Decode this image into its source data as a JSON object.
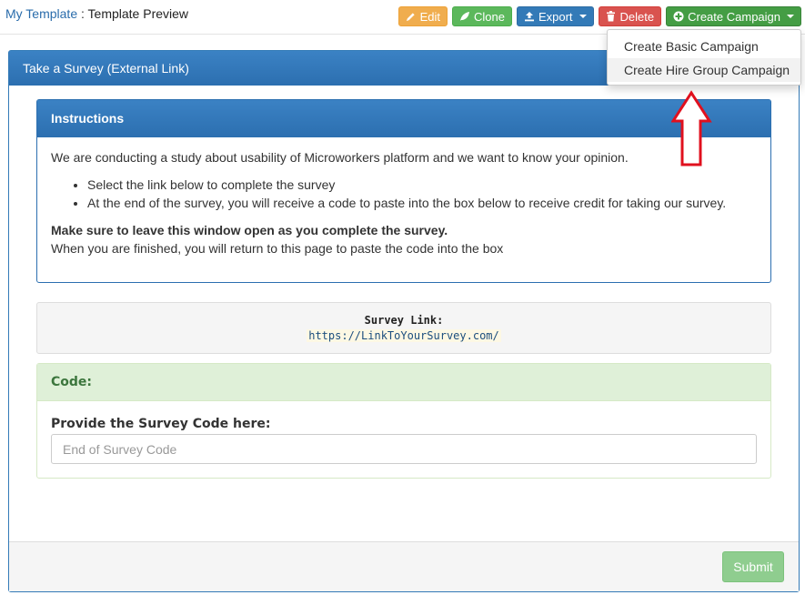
{
  "breadcrumb": {
    "link": "My Template",
    "separator": " : ",
    "current": "Template Preview"
  },
  "toolbar": {
    "edit_label": "Edit",
    "clone_label": "Clone",
    "export_label": "Export",
    "delete_label": "Delete",
    "create_label": "Create Campaign"
  },
  "dropdown": {
    "items": [
      {
        "label": "Create Basic Campaign"
      },
      {
        "label": "Create Hire Group Campaign"
      }
    ]
  },
  "panel": {
    "title": "Take a Survey (External Link)"
  },
  "instructions": {
    "title": "Instructions",
    "intro": "We are conducting a study about usability of Microworkers platform and we want to know your opinion.",
    "bullets": [
      "Select the link below to complete the survey",
      "At the end of the survey, you will receive a code to paste into the box below to receive credit for taking our survey."
    ],
    "warning": "Make sure to leave this window open as you complete the survey.",
    "note": "When you are finished, you will return to this page to paste the code into the box"
  },
  "survey": {
    "label": "Survey Link:",
    "url": "https://LinkToYourSurvey.com/"
  },
  "code": {
    "title": "Code:",
    "label": "Provide the Survey Code here:",
    "placeholder": "End of Survey Code"
  },
  "footer": {
    "submit_label": "Submit"
  },
  "colors": {
    "primary": "#337ab7",
    "success": "#5cb85c",
    "warning": "#f0ad4e",
    "danger": "#d9534f",
    "annotation_arrow": "#e0101e"
  }
}
